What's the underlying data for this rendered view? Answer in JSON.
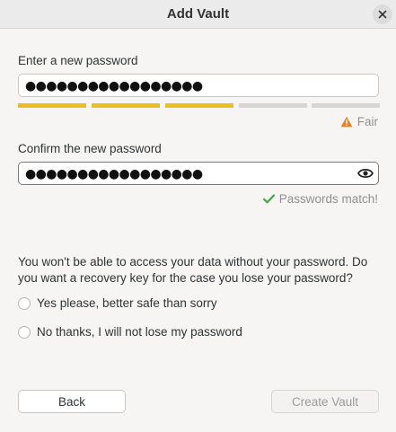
{
  "window": {
    "title": "Add Vault",
    "close_icon": "close-icon"
  },
  "password": {
    "label": "Enter a new password",
    "masked_value": "●●●●●●●●●●●●●●●●●",
    "strength": {
      "segments_filled": 3,
      "segments_total": 5,
      "filled_color": "#e9c01e",
      "empty_color": "#d6d6d6",
      "icon": "warning-icon",
      "text": "Fair"
    }
  },
  "confirm": {
    "label": "Confirm the new password",
    "masked_value": "●●●●●●●●●●●●●●●●●",
    "reveal_icon": "eye-icon",
    "match_icon": "checkmark-icon",
    "match_text": "Passwords match!"
  },
  "recovery": {
    "question": "You won't be able to access your data without your password. Do you want a recovery key for the case you lose your password?",
    "options": [
      "Yes please, better safe than sorry",
      "No thanks, I will not lose my password"
    ]
  },
  "buttons": {
    "back": "Back",
    "create": "Create Vault"
  },
  "colors": {
    "warning": "#e77f24",
    "success": "#3cae3c"
  }
}
